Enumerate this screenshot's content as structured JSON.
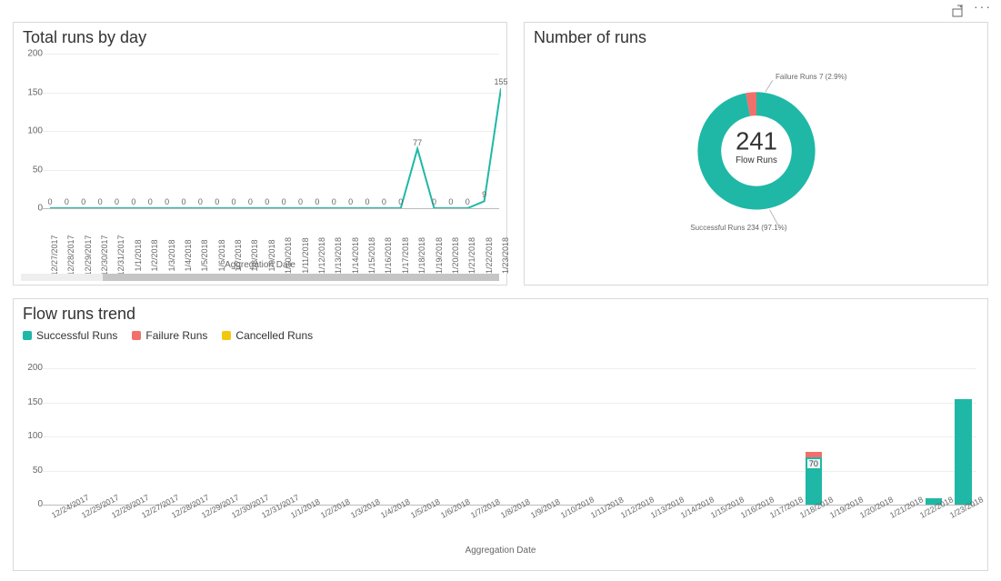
{
  "colors": {
    "teal": "#1fb8a6",
    "red": "#f1706c",
    "yellow": "#f2c80f",
    "grid": "#eeeeee",
    "axis": "#bbbbbb"
  },
  "actions": {
    "share_icon": "share-icon",
    "more_icon": "more-icon"
  },
  "chart_data": [
    {
      "id": "total_runs_by_day",
      "title": "Total runs by day",
      "type": "line",
      "xlabel": "Aggregation Date",
      "ylabel": "",
      "ylim": [
        0,
        200
      ],
      "yticks": [
        0,
        50,
        100,
        150,
        200
      ],
      "categories": [
        "12/27/2017",
        "12/28/2017",
        "12/29/2017",
        "12/30/2017",
        "12/31/2017",
        "1/1/2018",
        "1/2/2018",
        "1/3/2018",
        "1/4/2018",
        "1/5/2018",
        "1/6/2018",
        "1/7/2018",
        "1/8/2018",
        "1/9/2018",
        "1/10/2018",
        "1/11/2018",
        "1/12/2018",
        "1/13/2018",
        "1/14/2018",
        "1/15/2018",
        "1/16/2018",
        "1/17/2018",
        "1/18/2018",
        "1/19/2018",
        "1/20/2018",
        "1/21/2018",
        "1/22/2018",
        "1/23/2018"
      ],
      "values": [
        0,
        0,
        0,
        0,
        0,
        0,
        0,
        0,
        0,
        0,
        0,
        0,
        0,
        0,
        0,
        0,
        0,
        0,
        0,
        0,
        0,
        0,
        77,
        0,
        0,
        0,
        9,
        155
      ],
      "point_labels": [
        0,
        0,
        0,
        0,
        0,
        0,
        0,
        0,
        0,
        0,
        0,
        0,
        0,
        0,
        0,
        0,
        0,
        0,
        0,
        0,
        0,
        0,
        77,
        0,
        0,
        0,
        9,
        155
      ]
    },
    {
      "id": "number_of_runs",
      "title": "Number of runs",
      "type": "pie",
      "center_value": "241",
      "center_label": "Flow Runs",
      "slices": [
        {
          "name": "Successful Runs",
          "value": 234,
          "pct": "97.1%",
          "color": "#1fb8a6",
          "label": "Successful Runs 234 (97.1%)"
        },
        {
          "name": "Failure Runs",
          "value": 7,
          "pct": "2.9%",
          "color": "#f1706c",
          "label": "Failure Runs 7 (2.9%)"
        }
      ]
    },
    {
      "id": "flow_runs_trend",
      "title": "Flow runs trend",
      "type": "bar",
      "stacked": true,
      "xlabel": "Aggregation Date",
      "ylabel": "",
      "ylim": [
        0,
        200
      ],
      "yticks": [
        0,
        50,
        100,
        150,
        200
      ],
      "categories": [
        "12/24/2017",
        "12/25/2017",
        "12/26/2017",
        "12/27/2017",
        "12/28/2017",
        "12/29/2017",
        "12/30/2017",
        "12/31/2017",
        "1/1/2018",
        "1/2/2018",
        "1/3/2018",
        "1/4/2018",
        "1/5/2018",
        "1/6/2018",
        "1/7/2018",
        "1/8/2018",
        "1/9/2018",
        "1/10/2018",
        "1/11/2018",
        "1/12/2018",
        "1/13/2018",
        "1/14/2018",
        "1/15/2018",
        "1/16/2018",
        "1/17/2018",
        "1/18/2018",
        "1/19/2018",
        "1/20/2018",
        "1/21/2018",
        "1/22/2018",
        "1/23/2018"
      ],
      "series": [
        {
          "name": "Successful Runs",
          "color": "#1fb8a6",
          "values": [
            0,
            0,
            0,
            0,
            0,
            0,
            0,
            0,
            0,
            0,
            0,
            0,
            0,
            0,
            0,
            0,
            0,
            0,
            0,
            0,
            0,
            0,
            0,
            0,
            0,
            70,
            0,
            0,
            0,
            9,
            155
          ]
        },
        {
          "name": "Failure Runs",
          "color": "#f1706c",
          "values": [
            0,
            0,
            0,
            0,
            0,
            0,
            0,
            0,
            0,
            0,
            0,
            0,
            0,
            0,
            0,
            0,
            0,
            0,
            0,
            0,
            0,
            0,
            0,
            0,
            0,
            7,
            0,
            0,
            0,
            0,
            0
          ]
        },
        {
          "name": "Cancelled Runs",
          "color": "#f2c80f",
          "values": [
            0,
            0,
            0,
            0,
            0,
            0,
            0,
            0,
            0,
            0,
            0,
            0,
            0,
            0,
            0,
            0,
            0,
            0,
            0,
            0,
            0,
            0,
            0,
            0,
            0,
            0,
            0,
            0,
            0,
            0,
            0
          ]
        }
      ],
      "bar_labels": {
        "25": "70"
      }
    }
  ]
}
